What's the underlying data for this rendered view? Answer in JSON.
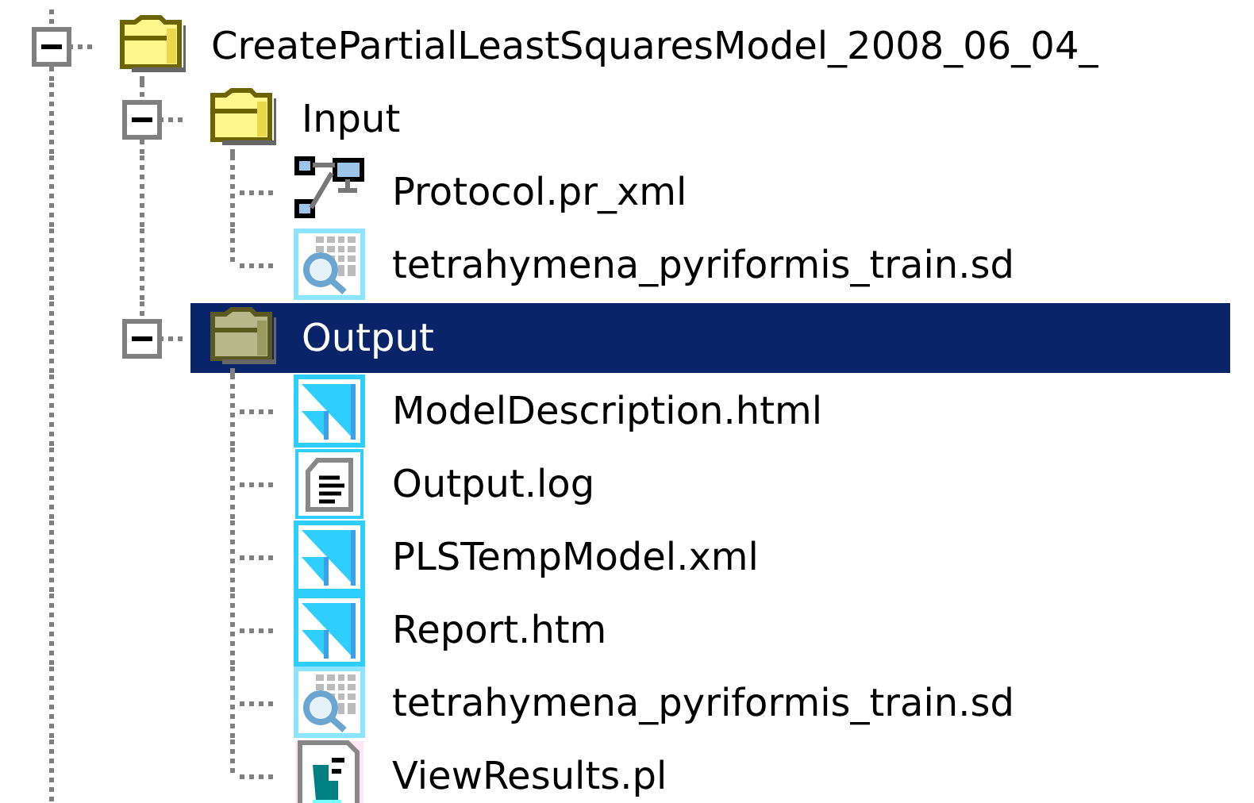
{
  "tree": [
    {
      "kind": "folder",
      "label": "CreatePartialLeastSquaresModel_2008_06_04_",
      "expanded": true,
      "selected": false,
      "children": [
        {
          "kind": "folder",
          "label": "Input",
          "expanded": true,
          "selected": false,
          "children": [
            {
              "kind": "protocol",
              "label": "Protocol.pr_xml",
              "selected": false
            },
            {
              "kind": "sd",
              "label": "tetrahymena_pyriformis_train.sd",
              "selected": false
            }
          ]
        },
        {
          "kind": "folder",
          "label": "Output",
          "expanded": true,
          "selected": true,
          "children": [
            {
              "kind": "html",
              "label": "ModelDescription.html",
              "selected": false
            },
            {
              "kind": "log",
              "label": "Output.log",
              "selected": false
            },
            {
              "kind": "html",
              "label": "PLSTempModel.xml",
              "selected": false
            },
            {
              "kind": "html",
              "label": "Report.htm",
              "selected": false
            },
            {
              "kind": "sd",
              "label": "tetrahymena_pyriformis_train.sd",
              "selected": false
            },
            {
              "kind": "pl",
              "label": "ViewResults.pl",
              "selected": false
            }
          ]
        }
      ]
    }
  ]
}
